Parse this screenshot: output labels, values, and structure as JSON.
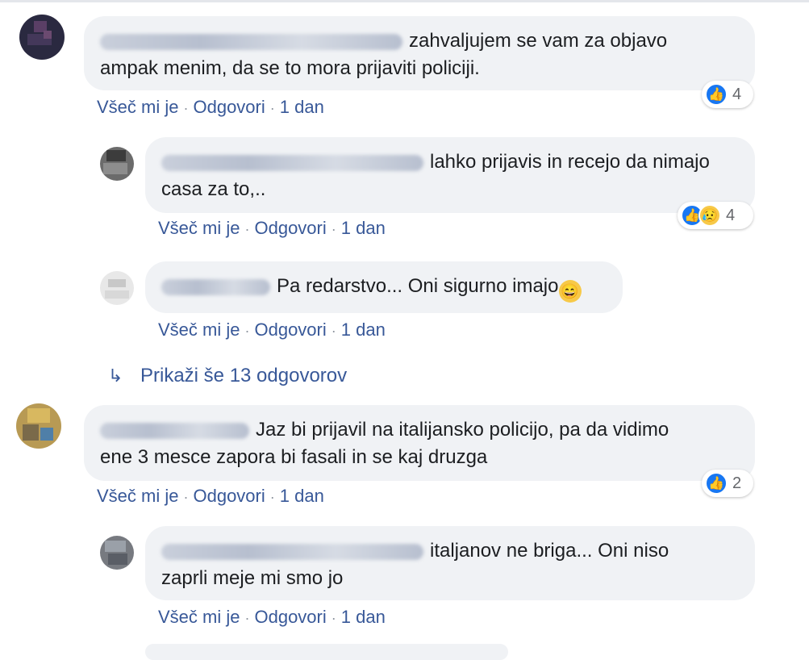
{
  "comments": [
    {
      "id": "c1",
      "text": "zahvaljujem se vam za objavo ampak menim, da se to mora prijaviti policiji.",
      "line1": "zahvaljujem se vam za objavo",
      "line2": "ampak menim, da se to mora prijaviti policiji.",
      "like_label": "Všeč mi je",
      "reply_label": "Odgovori",
      "time": "1 dan",
      "reaction_count": "4"
    },
    {
      "id": "r1",
      "line1": "lahko prijavis in recejo da nimajo",
      "line2": "casa za to,..",
      "like_label": "Všeč mi je",
      "reply_label": "Odgovori",
      "time": "1 dan",
      "reaction_count": "4"
    },
    {
      "id": "r2",
      "line1": "Pa redarstvo... Oni sigurno imajo",
      "like_label": "Všeč mi je",
      "reply_label": "Odgovori",
      "time": "1 dan"
    },
    {
      "id": "c2",
      "line1": "Jaz bi prijavil na italijansko policijo, pa da vidimo",
      "line2": "ene 3 mesce zapora bi fasali in se kaj druzga",
      "like_label": "Všeč mi je",
      "reply_label": "Odgovori",
      "time": "1 dan",
      "reaction_count": "2"
    },
    {
      "id": "r3",
      "line1": "italjanov ne briga... Oni niso",
      "line2": "zaprli meje mi smo jo",
      "like_label": "Všeč mi je",
      "reply_label": "Odgovori",
      "time": "1 dan"
    }
  ],
  "more_replies_label": "Prikaži še 13 odgovorov",
  "colors": {
    "bubble": "#f0f2f5",
    "link": "#385898",
    "like": "#1877f2"
  },
  "icons": [
    "like-icon",
    "sad-icon",
    "grinning-emoji-icon",
    "reply-arrow-icon"
  ]
}
